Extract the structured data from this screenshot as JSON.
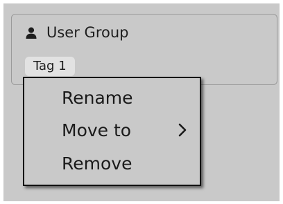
{
  "group": {
    "title": "User Group",
    "icon": "user-icon",
    "tag_label": "Tag 1"
  },
  "context_menu": {
    "items": [
      {
        "label": "Rename",
        "has_submenu": false
      },
      {
        "label": "Move to",
        "has_submenu": true,
        "submenu_icon": "chevron-right-icon"
      },
      {
        "label": "Remove",
        "has_submenu": false
      }
    ]
  },
  "colors": {
    "background": "#c9c9c9",
    "card_border": "#9a9a9a",
    "tag_background": "#e2e2e2",
    "menu_border": "#111111",
    "text": "#1e1e1e"
  }
}
